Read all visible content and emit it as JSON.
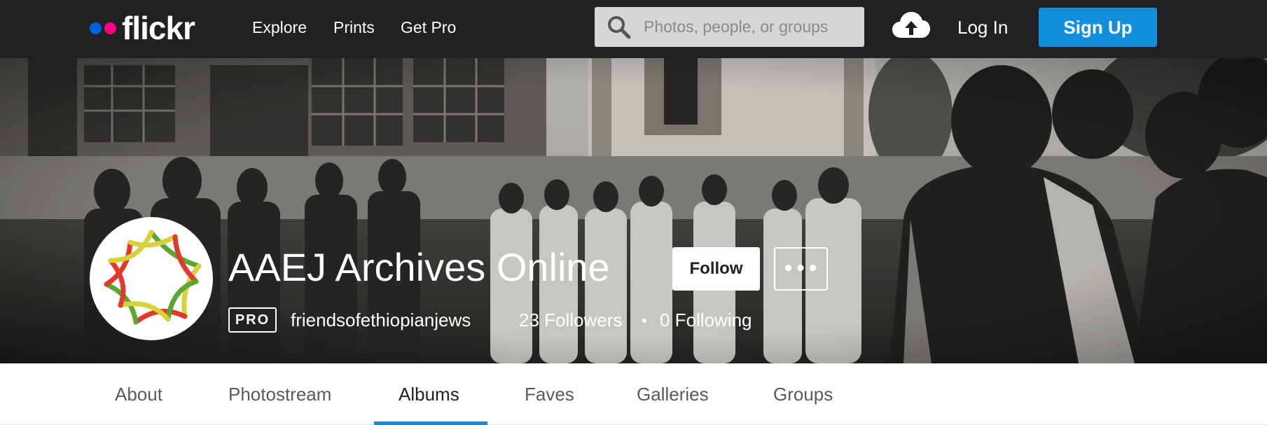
{
  "header": {
    "logo_text": "flickr",
    "nav": [
      "Explore",
      "Prints",
      "Get Pro"
    ],
    "search_placeholder": "Photos, people, or groups",
    "upload_icon": "cloud-upload-icon",
    "login_label": "Log In",
    "signup_label": "Sign Up",
    "colors": {
      "bar": "#212124",
      "logo_blue": "#0063dc",
      "logo_pink": "#ff0084",
      "signup": "#128fdc"
    }
  },
  "profile": {
    "title": "AAEJ Archives Online",
    "follow_label": "Follow",
    "more_label": "•••",
    "pro_badge": "PRO",
    "username": "friendsofethiopianjews",
    "followers": "23 Followers",
    "following": "0 Following"
  },
  "tabs": {
    "items": [
      "About",
      "Photostream",
      "Albums",
      "Faves",
      "Galleries",
      "Groups"
    ],
    "active": "Albums",
    "accent": "#128fdc"
  }
}
